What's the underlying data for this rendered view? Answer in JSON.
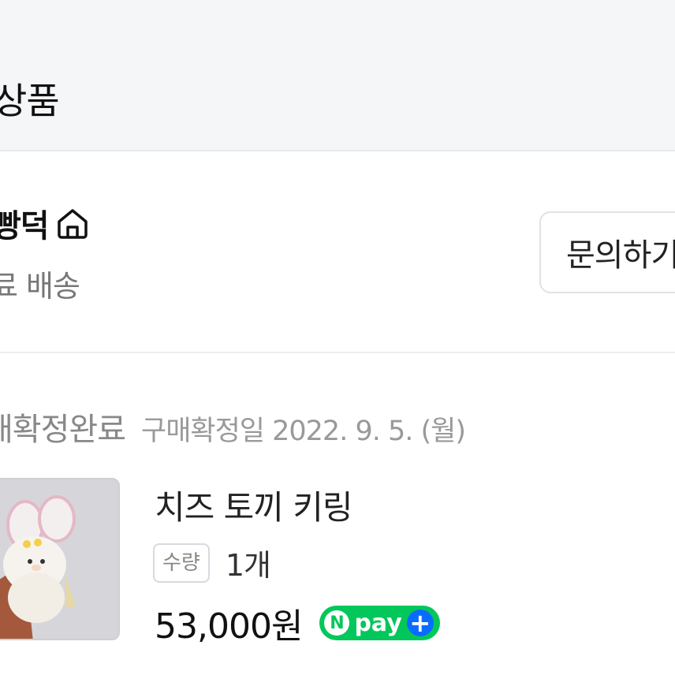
{
  "header": {
    "title": "상품"
  },
  "store": {
    "name": "빵덕",
    "shipping": "료 배송",
    "inquiry_label": "문의하기"
  },
  "order": {
    "status": "매확정완료",
    "confirm_date": "구매확정일 2022. 9. 5. (월)",
    "product": {
      "name": "치즈 토끼 키링",
      "quantity_label": "수량",
      "quantity_value": "1개",
      "price": "53,000원",
      "payment": "pay"
    }
  },
  "colors": {
    "npay_green": "#03c75a",
    "npay_plus_blue": "#0a6cff"
  },
  "icons": [
    "home-icon",
    "npay-logo"
  ]
}
